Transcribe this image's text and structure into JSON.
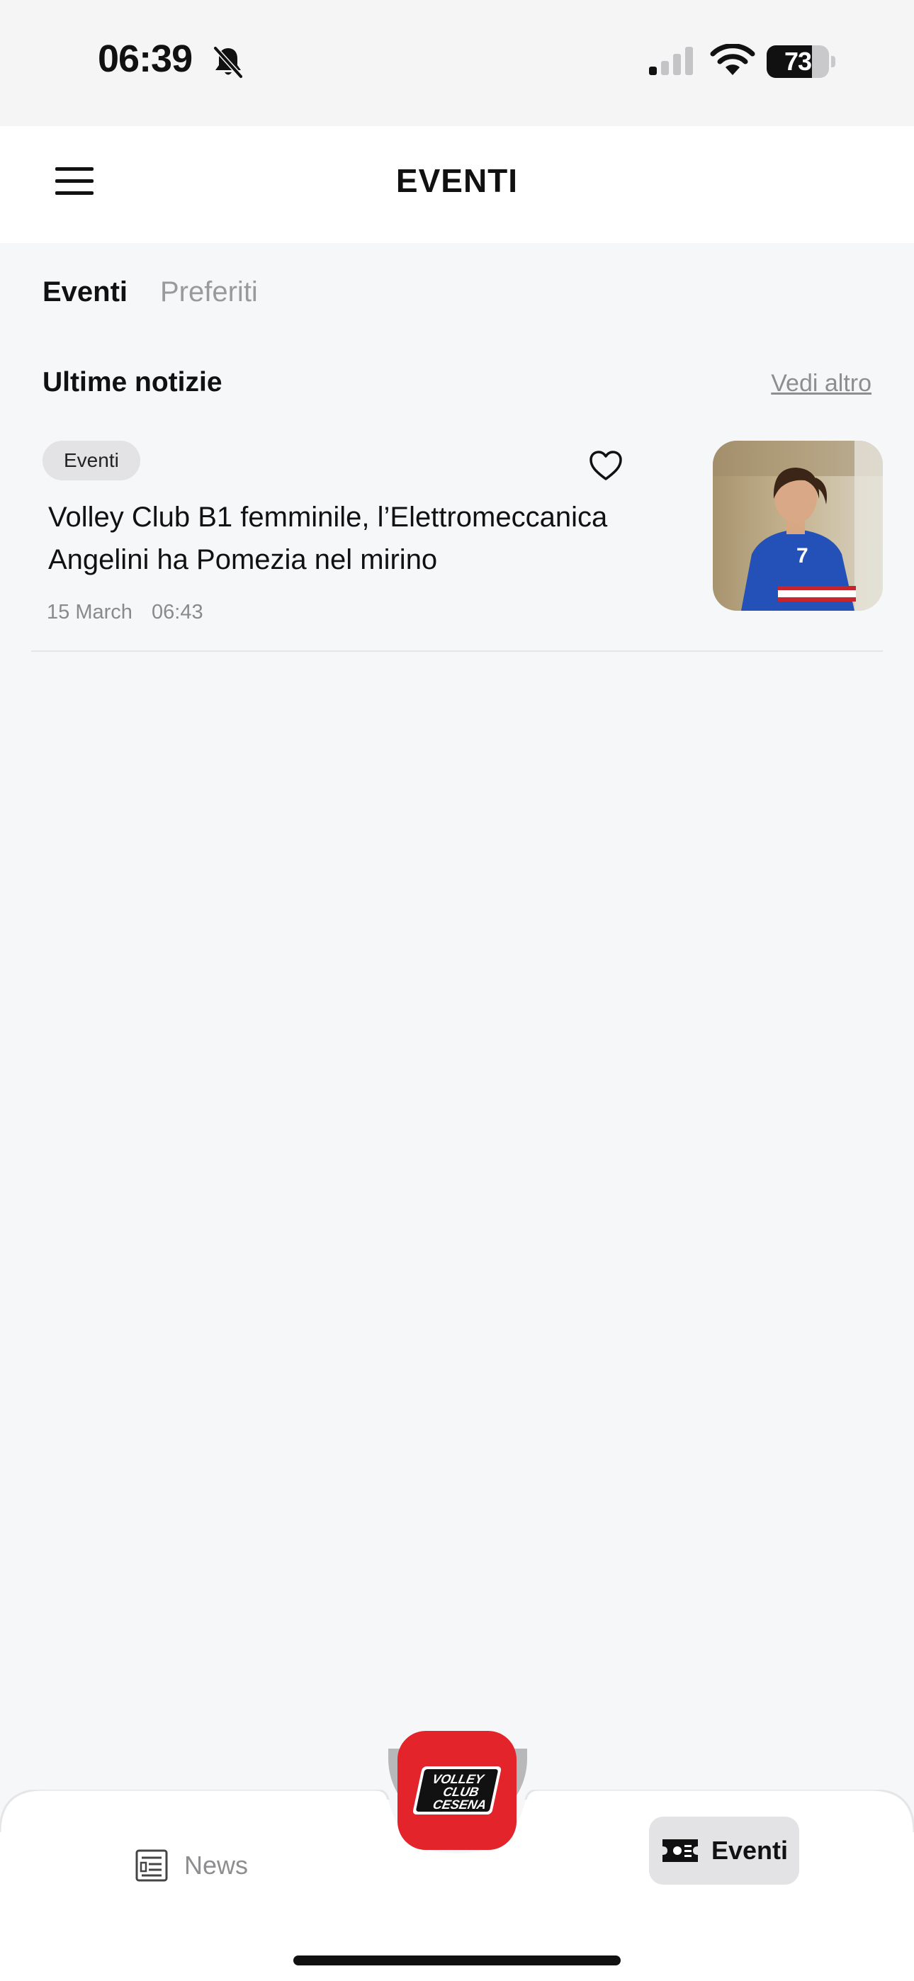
{
  "status_bar": {
    "time": "06:39",
    "battery_level": "73",
    "battery_fraction": 0.73,
    "icons": [
      "bell-slash-icon",
      "cellular-signal-icon",
      "wifi-icon",
      "battery-icon"
    ]
  },
  "header": {
    "title": "EVENTI",
    "menu_icon": "hamburger-menu-icon"
  },
  "tabs": [
    {
      "label": "Eventi",
      "active": true
    },
    {
      "label": "Preferiti",
      "active": false
    }
  ],
  "section": {
    "title": "Ultime notizie",
    "see_more": "Vedi altro"
  },
  "news": [
    {
      "category": "Eventi",
      "title_line1": "Volley Club B1 femminile, l’Elettromeccanica",
      "title_line2": "Angelini ha Pomezia nel mirino",
      "date": "15 March",
      "time": "06:43",
      "favorite_icon": "heart-outline-icon",
      "thumbnail": "volleyball-player-photo"
    }
  ],
  "bottom_nav": {
    "items": [
      {
        "label": "News",
        "icon": "newspaper-icon",
        "active": false
      },
      {
        "label": "Eventi",
        "icon": "ticket-icon",
        "active": true
      }
    ],
    "center_logo": {
      "icon": "volley-club-cesena-logo",
      "text_lines": [
        "VOLLEY",
        "CLUB",
        "CESENA"
      ],
      "color": "#e3242b"
    }
  },
  "colors": {
    "background": "#f6f7f9",
    "accent_red": "#e3242b",
    "muted_text": "#8e8e90"
  }
}
